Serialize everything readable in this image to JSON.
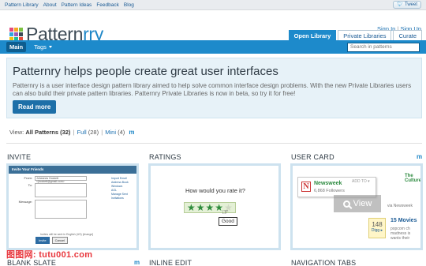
{
  "topnav": {
    "links": [
      "Pattern Library",
      "About",
      "Pattern Ideas",
      "Feedback",
      "Blog"
    ],
    "tweet_label": "Tweet"
  },
  "brand": {
    "name_main": "Pattern",
    "name_accent": "rry",
    "grid_colors": [
      "#e34a7c",
      "#f6a623",
      "#7cc242",
      "#2fa7e0",
      "#9b59b6",
      "#3c4a55",
      "#f1c40f",
      "#1abc9c",
      "#e74c3c"
    ]
  },
  "auth": {
    "signin": "Sign In",
    "signup": "Sign Up"
  },
  "tabs": [
    {
      "label": "Open Library",
      "active": true
    },
    {
      "label": "Private Libraries",
      "active": false
    },
    {
      "label": "Curate",
      "active": false
    }
  ],
  "mainnav": {
    "main_label": "Main",
    "tags_label": "Tags",
    "search_placeholder": "Search in patterns"
  },
  "hero": {
    "title": "Patternry helps people create great user interfaces",
    "body": "Patternry is a user interface design pattern library aimed to help solve common interface design problems. With the new Private Libraries users can also build their private pattern libraries. Patternry Private Libraries is now in beta, so try it for free!",
    "button": "Read more"
  },
  "viewfilter": {
    "prefix": "View:",
    "all": "All Patterns (32)",
    "full": "Full",
    "full_count": "(28)",
    "mini": "Mini",
    "mini_count": "(4)",
    "m": "m"
  },
  "cards": [
    {
      "title": "INVITE",
      "m": "",
      "thumb": {
        "header": "Invite Your Friends",
        "from_label": "From:",
        "from_value": "Johannes Hockett <jhockett@gmail.com>",
        "to_label": "To:",
        "message_label": "Message:",
        "sidebar": [
          "Import Email",
          "Address Book",
          "",
          "Windows",
          "AOL",
          "",
          "Manage Sent",
          "Invitations"
        ],
        "note": "Invites will be sent in English (US) [change]",
        "invite_btn": "Invite",
        "cancel_btn": "Cancel"
      }
    },
    {
      "title": "RATINGS",
      "m": "",
      "thumb": {
        "question": "How would you rate it?",
        "stars_filled": 4,
        "stars_total": 5,
        "tooltip": "Good"
      }
    },
    {
      "title": "USER CARD",
      "m": "m",
      "thumb": {
        "addto": "ADD TO ▾",
        "name": "Newsweek",
        "followers": "6,868 Followers",
        "cult": "The Culture",
        "overlay": "View",
        "right_lines": [
          "via Newsweek",
          "",
          "",
          "",
          "15 Movies"
        ],
        "snippet_lines": [
          "popcorn ch",
          "madness is",
          "wants their"
        ],
        "digg_count": "148",
        "digg_label": "Digg ▸"
      }
    }
  ],
  "row2": [
    {
      "title": "BLANK SLATE",
      "m": "m"
    },
    {
      "title": "INLINE EDIT",
      "m": ""
    },
    {
      "title": "NAVIGATION TABS",
      "m": ""
    }
  ],
  "watermark": "图图网: tutu001.com"
}
